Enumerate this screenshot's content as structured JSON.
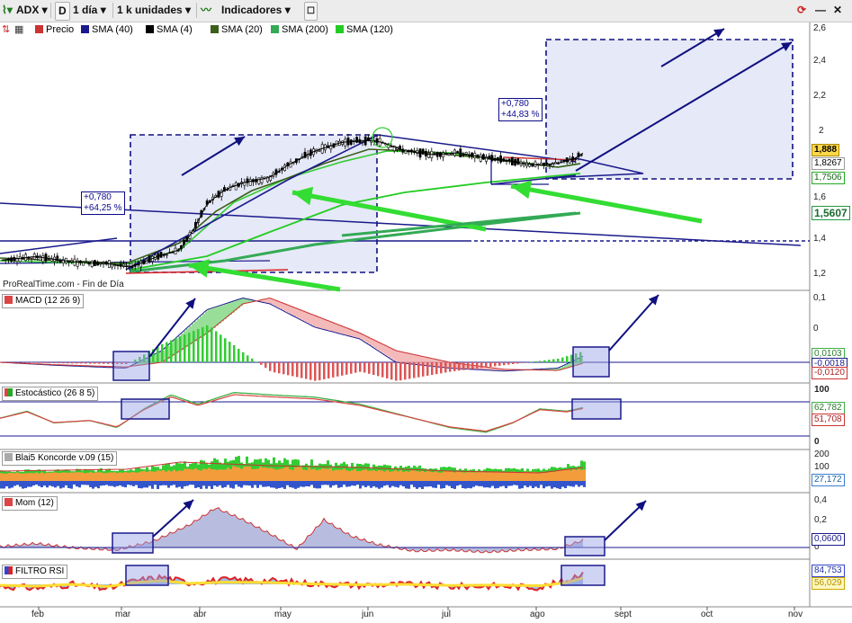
{
  "toolbar": {
    "symbol": "ADX",
    "d_button": "D",
    "timeframe": "1 día",
    "units": "1 k unidades",
    "indicators": "Indicadores"
  },
  "legend": [
    {
      "label": "Precio",
      "color": "#cc3333"
    },
    {
      "label": "SMA (40)",
      "color": "#1a1a8c"
    },
    {
      "label": "SMA (4)",
      "color": "#000000"
    },
    {
      "label": "SMA (20)",
      "color": "#3a5f1a"
    },
    {
      "label": "SMA (200)",
      "color": "#33aa55"
    },
    {
      "label": "SMA (120)",
      "color": "#22cc22"
    }
  ],
  "footer_note": "ProRealTime.com - Fin de Día",
  "annotations": {
    "left": [
      "+0,780",
      "+64,25 %"
    ],
    "right": [
      "+0,780",
      "+44,83 %"
    ]
  },
  "x_axis": [
    "feb",
    "mar",
    "abr",
    "may",
    "jun",
    "jul",
    "ago",
    "sept",
    "oct",
    "nov"
  ],
  "panels": {
    "price": {
      "ticks": [
        "2,6",
        "2,4",
        "2,2",
        "2",
        "1,6",
        "1,4",
        "1,2"
      ],
      "badges": [
        "1,888",
        "1,8267",
        "1,7506",
        "1,5607"
      ]
    },
    "macd": {
      "label": "MACD (12 26 9)",
      "ticks": [
        "0,1",
        "0",
        "-0,1"
      ],
      "badges": [
        "0,0103",
        "-0,0018",
        "-0,0120"
      ]
    },
    "stoch": {
      "label": "Estocástico (26 8 5)",
      "ticks": [
        "100",
        "0"
      ],
      "badges": [
        "62,782",
        "51,708"
      ]
    },
    "koncorde": {
      "label": "Blai5 Koncorde v.09 (15)",
      "ticks": [
        "200",
        "100",
        "0"
      ],
      "badges": [
        "27,172"
      ]
    },
    "mom": {
      "label": "Mom (12)",
      "ticks": [
        "0,4",
        "0,2",
        "0"
      ],
      "badges": [
        "0,0600"
      ]
    },
    "rsi": {
      "label": "FILTRO RSI",
      "badges": [
        "84,753",
        "56,029"
      ]
    }
  },
  "chart_data": [
    {
      "type": "line",
      "title": "ADX",
      "x": [
        "feb",
        "mar",
        "abr",
        "may",
        "jun",
        "jul",
        "ago"
      ],
      "series": [
        {
          "name": "Precio",
          "values": [
            1.28,
            1.25,
            1.55,
            1.8,
            1.95,
            1.88,
            1.888
          ]
        },
        {
          "name": "SMA (40)",
          "values": [
            1.26,
            1.26,
            1.4,
            1.66,
            1.86,
            1.86,
            1.8267
          ]
        },
        {
          "name": "SMA (200)",
          "values": [
            1.22,
            1.23,
            1.3,
            1.4,
            1.45,
            1.52,
            1.5607
          ]
        },
        {
          "name": "SMA (120)",
          "values": [
            1.24,
            1.24,
            1.3,
            1.5,
            1.65,
            1.72,
            1.7506
          ]
        }
      ],
      "ylim": [
        1.1,
        2.6
      ]
    },
    {
      "type": "line",
      "title": "MACD (12 26 9)",
      "x": [
        "feb",
        "mar",
        "abr",
        "may",
        "jun",
        "jul",
        "ago"
      ],
      "series": [
        {
          "name": "MACD",
          "values": [
            -0.005,
            -0.01,
            0.09,
            0.06,
            -0.01,
            -0.015,
            0.0103
          ]
        },
        {
          "name": "Señal",
          "values": [
            -0.004,
            -0.008,
            0.07,
            0.07,
            0.0,
            -0.015,
            -0.0018
          ]
        }
      ],
      "ylim": [
        -0.12,
        0.12
      ]
    },
    {
      "type": "line",
      "title": "Estocástico (26 8 5)",
      "x": [
        "feb",
        "mar",
        "abr",
        "may",
        "jun",
        "jul",
        "ago"
      ],
      "series": [
        {
          "name": "%K",
          "values": [
            40,
            30,
            90,
            85,
            50,
            15,
            62.782
          ]
        },
        {
          "name": "%D",
          "values": [
            42,
            32,
            85,
            88,
            55,
            18,
            51.708
          ]
        }
      ],
      "ylim": [
        0,
        100
      ]
    },
    {
      "type": "area",
      "title": "Blai5 Koncorde v.09 (15)",
      "x": [
        "feb",
        "mar",
        "abr",
        "may",
        "jun",
        "jul",
        "ago"
      ],
      "series": [
        {
          "name": "Koncorde",
          "values": [
            20,
            30,
            80,
            70,
            40,
            25,
            27.172
          ]
        }
      ],
      "ylim": [
        0,
        200
      ]
    },
    {
      "type": "area",
      "title": "Mom (12)",
      "x": [
        "feb",
        "mar",
        "abr",
        "may",
        "jun",
        "jul",
        "ago"
      ],
      "series": [
        {
          "name": "Mom",
          "values": [
            0.03,
            -0.02,
            0.36,
            0.2,
            -0.05,
            -0.03,
            0.06
          ]
        }
      ],
      "ylim": [
        -0.08,
        0.45
      ]
    },
    {
      "type": "line",
      "title": "FILTRO RSI",
      "x": [
        "feb",
        "mar",
        "abr",
        "may",
        "jun",
        "jul",
        "ago"
      ],
      "series": [
        {
          "name": "RSI",
          "values": [
            45,
            40,
            70,
            60,
            50,
            42,
            84.753
          ]
        },
        {
          "name": "Filtro",
          "values": [
            48,
            45,
            60,
            58,
            52,
            46,
            56.029
          ]
        }
      ],
      "ylim": [
        0,
        100
      ]
    }
  ],
  "colors": {
    "price_up": "#1a7a1a",
    "price_down": "#cc2222",
    "sma40": "#1a1a8c",
    "sma20": "#3a5f1a",
    "sma200": "#33aa55",
    "sma120": "#22cc22",
    "arrow_blue": "#101080",
    "arrow_green": "#33dd33",
    "box_fill": "#e6e9f7"
  }
}
